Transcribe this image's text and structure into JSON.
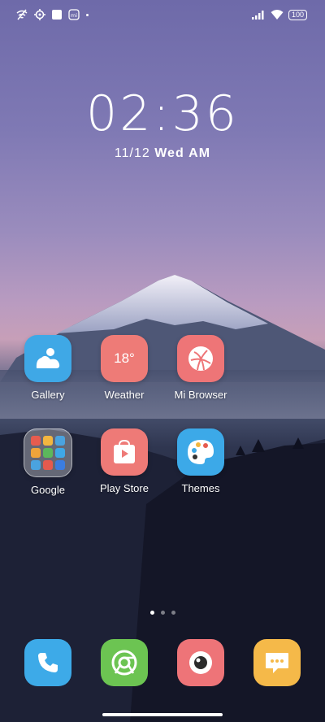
{
  "status_bar": {
    "left_icons": [
      "wifi-off-icon",
      "location-icon",
      "square-icon",
      "mi-icon",
      "dot-icon"
    ],
    "right_icons": [
      "signal-icon",
      "wifi-icon"
    ],
    "battery": "100"
  },
  "clock": {
    "time": "02:36",
    "date": "11/12",
    "day": "Wed",
    "ampm": "AM"
  },
  "apps": [
    {
      "label": "Gallery",
      "icon": "gallery-icon",
      "color": "#3fa8e6"
    },
    {
      "label": "Weather",
      "icon": "weather-icon",
      "color": "#ee7b77",
      "text": "18°"
    },
    {
      "label": "Mi Browser",
      "icon": "browser-icon",
      "color": "#ee7577"
    },
    {
      "label": "Google",
      "icon": "google-folder-icon",
      "color": "rgba(255,255,255,0.35)"
    },
    {
      "label": "Play Store",
      "icon": "play-store-icon",
      "color": "#ee7a77"
    },
    {
      "label": "Themes",
      "icon": "themes-icon",
      "color": "#3ca9e8"
    }
  ],
  "page_indicator": {
    "count": 3,
    "active": 0
  },
  "dock": [
    {
      "icon": "phone-icon",
      "color": "#3daae8"
    },
    {
      "icon": "chrome-icon",
      "color": "#6cc452"
    },
    {
      "icon": "camera-icon",
      "color": "#ee7478"
    },
    {
      "icon": "messages-icon",
      "color": "#f5b949"
    }
  ]
}
